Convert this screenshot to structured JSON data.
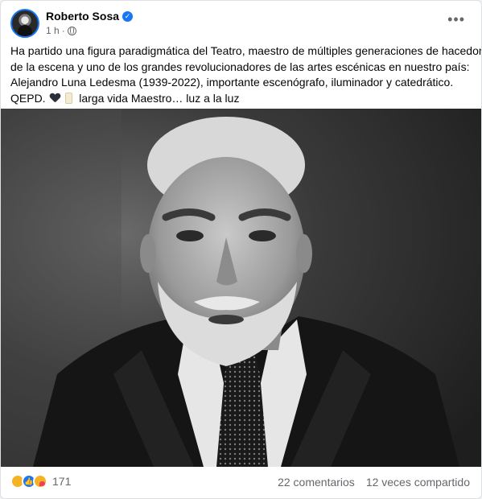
{
  "post": {
    "author": "Roberto Sosa",
    "time": "1 h",
    "separator": "·",
    "text_lines": [
      "Ha partido una figura paradigmática del Teatro, maestro de múltiples generaciones de hacedores",
      "de la escena y uno de los grandes revolucionadores de las artes escénicas en nuestro país:",
      "Alejandro Luna Ledesma (1939-2022), importante escenógrafo, iluminador y catedrático."
    ],
    "last_line_prefix": "QEPD.",
    "last_line_suffix": "larga vida Maestro… luz a la luz",
    "emojis": [
      "black-heart",
      "scroll"
    ],
    "more_label": "•••"
  },
  "footer": {
    "reaction_icons": [
      "sad-reaction",
      "like-reaction",
      "care-reaction"
    ],
    "reaction_count": "171",
    "comments": "22 comentarios",
    "shares": "12 veces compartido"
  },
  "colors": {
    "accent": "#1877f2",
    "secondary_text": "#65676b",
    "primary_text": "#050505"
  }
}
